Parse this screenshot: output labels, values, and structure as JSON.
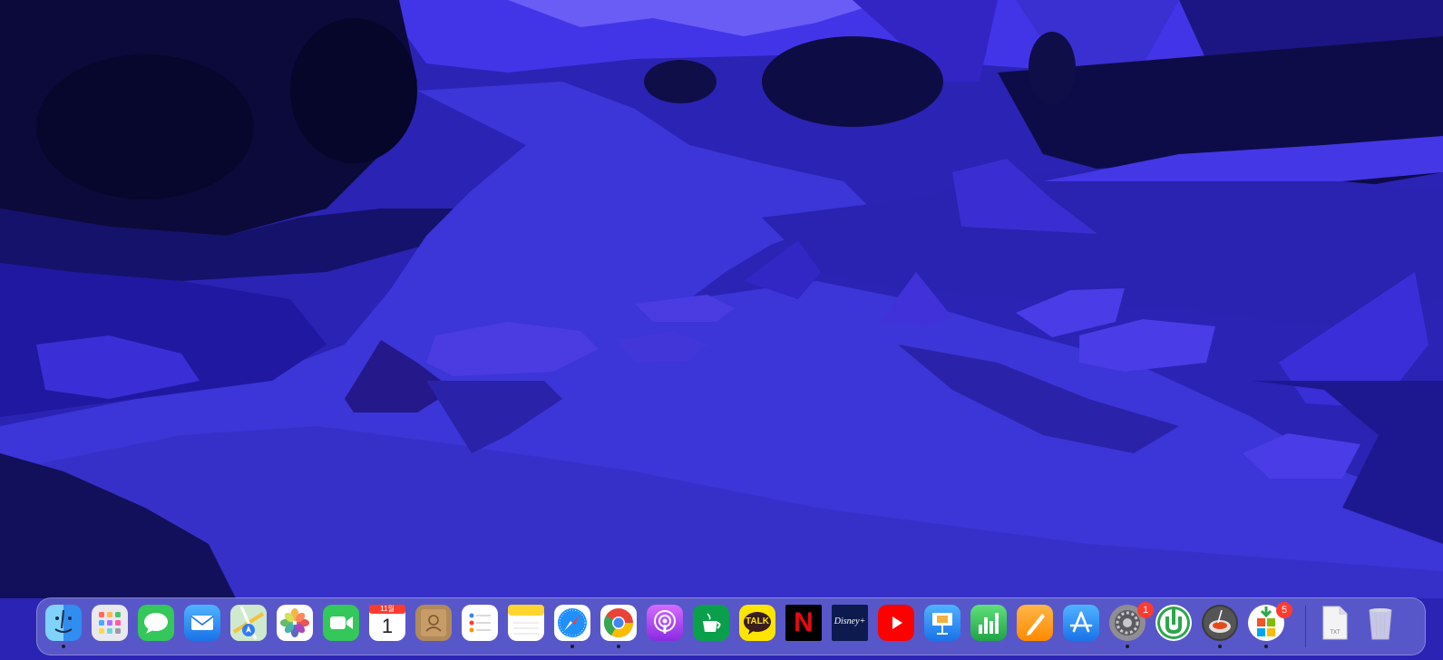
{
  "dock": {
    "apps": [
      {
        "name": "Finder",
        "icon": "finder-icon",
        "running": true
      },
      {
        "name": "Launchpad",
        "icon": "launchpad-icon",
        "running": false
      },
      {
        "name": "Messages",
        "icon": "messages-icon",
        "running": false
      },
      {
        "name": "Mail",
        "icon": "mail-icon",
        "running": false
      },
      {
        "name": "Maps",
        "icon": "maps-icon",
        "running": false
      },
      {
        "name": "Photos",
        "icon": "photos-icon",
        "running": false
      },
      {
        "name": "FaceTime",
        "icon": "facetime-icon",
        "running": false
      },
      {
        "name": "Calendar",
        "icon": "calendar-icon",
        "running": false,
        "month": "11월",
        "day": "1"
      },
      {
        "name": "Contacts",
        "icon": "contacts-icon",
        "running": false
      },
      {
        "name": "Reminders",
        "icon": "reminders-icon",
        "running": false
      },
      {
        "name": "Notes",
        "icon": "notes-icon",
        "running": false
      },
      {
        "name": "Safari",
        "icon": "safari-icon",
        "running": true
      },
      {
        "name": "Google Chrome",
        "icon": "chrome-icon",
        "running": true
      },
      {
        "name": "Podcasts",
        "icon": "podcasts-icon",
        "running": false
      },
      {
        "name": "Starbucks",
        "icon": "starbucks-icon",
        "running": false
      },
      {
        "name": "KakaoTalk",
        "icon": "kakaotalk-icon",
        "running": false,
        "label": "TALK"
      },
      {
        "name": "Netflix",
        "icon": "netflix-icon",
        "running": false,
        "label": "N"
      },
      {
        "name": "Disney+",
        "icon": "disney-plus-icon",
        "running": false,
        "label": "Disney+"
      },
      {
        "name": "YouTube",
        "icon": "youtube-icon",
        "running": false
      },
      {
        "name": "Keynote",
        "icon": "keynote-icon",
        "running": false
      },
      {
        "name": "Numbers",
        "icon": "numbers-icon",
        "running": false
      },
      {
        "name": "Pages",
        "icon": "pages-icon",
        "running": false
      },
      {
        "name": "App Store",
        "icon": "app-store-icon",
        "running": false
      },
      {
        "name": "System Preferences",
        "icon": "system-preferences-icon",
        "running": true,
        "badge": "1"
      },
      {
        "name": "uTorrent",
        "icon": "utorrent-icon",
        "running": false
      },
      {
        "name": "Steam Cooking",
        "icon": "cooking-app-icon",
        "running": true
      },
      {
        "name": "Microsoft AutoUpdate",
        "icon": "ms-autoupdate-icon",
        "running": true,
        "badge": "5"
      }
    ],
    "right": [
      {
        "name": "Document",
        "icon": "txt-document-icon",
        "label": "TXT"
      },
      {
        "name": "Trash",
        "icon": "trash-icon"
      }
    ]
  },
  "colors": {
    "wallpaper_base": "#2a22b8",
    "water": "#3a33d6",
    "shadow": "#12105a",
    "badge": "#ff3b30"
  }
}
